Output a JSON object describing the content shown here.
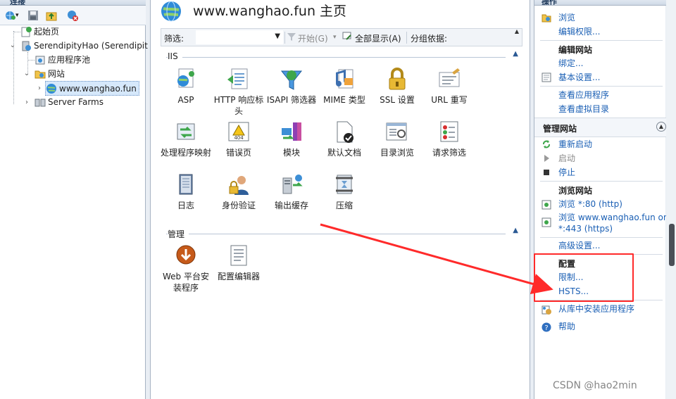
{
  "window": {
    "left_pane_title": "连接",
    "right_pane_title": "操作"
  },
  "tree": {
    "start_page": "起始页",
    "server": "SerendipityHao (Serendipit",
    "app_pools": "应用程序池",
    "sites": "网站",
    "site": "www.wanghao.fun",
    "server_farms": "Server Farms"
  },
  "header": {
    "title": "www.wanghao.fun 主页"
  },
  "filter_bar": {
    "filter_label": "筛选:",
    "filter_value": "",
    "start_label": "开始(G)",
    "show_all_label": "全部显示(A)",
    "group_by_label": "分组依据:"
  },
  "groups": {
    "iis": "IIS",
    "manage": "管理"
  },
  "features": {
    "asp": "ASP",
    "http_headers": "HTTP 响应标头",
    "isapi_filters": "ISAPI 筛选器",
    "mime_types": "MIME 类型",
    "ssl": "SSL 设置",
    "url_rewrite": "URL 重写",
    "handler_mappings": "处理程序映射",
    "error_pages": "错误页",
    "modules": "模块",
    "default_document": "默认文档",
    "directory_browsing": "目录浏览",
    "request_filtering": "请求筛选",
    "logging": "日志",
    "authentication": "身份验证",
    "output_caching": "输出缓存",
    "compression": "压缩",
    "web_platform_installer": "Web 平台安装程序",
    "config_editor": "配置编辑器"
  },
  "actions": {
    "browse": "浏览",
    "edit_permissions": "编辑权限...",
    "edit_site_head": "编辑网站",
    "bindings": "绑定...",
    "basic_settings": "基本设置...",
    "view_apps": "查看应用程序",
    "view_vdirs": "查看虚拟目录",
    "manage_site_head": "管理网站",
    "restart": "重新启动",
    "start": "启动",
    "stop": "停止",
    "browse_site_head": "浏览网站",
    "browse_80": "浏览 *:80 (http)",
    "browse_443_line1": "浏览 www.wanghao.fun on",
    "browse_443_line2": "*:443 (https)",
    "advanced_settings": "高级设置...",
    "configure_head": "配置",
    "limits": "限制...",
    "hsts": "HSTS...",
    "install_from_gallery": "从库中安装应用程序",
    "help": "帮助"
  },
  "watermark": "CSDN @hao2min",
  "colors": {
    "link": "#1a5fb4",
    "annotation": "#ff2a2a"
  }
}
